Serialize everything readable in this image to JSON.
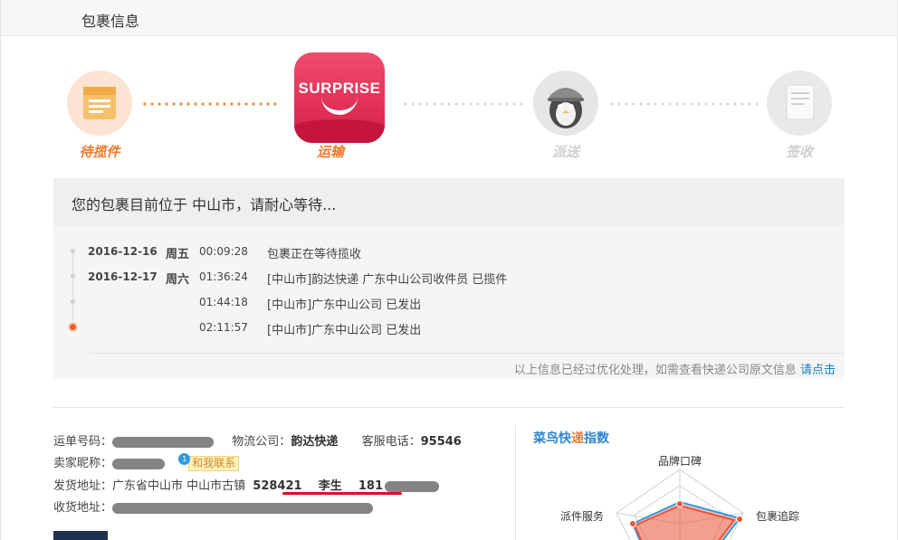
{
  "header": {
    "title": "包裹信息"
  },
  "steps": [
    {
      "label": "待揽件",
      "state": "done",
      "icon": "package-box-icon",
      "color": "#f07828"
    },
    {
      "label": "运输",
      "state": "current",
      "icon": "surprise-logo-icon",
      "logo_text": "SURPRISE",
      "color": "#f07828"
    },
    {
      "label": "派送",
      "state": "pending",
      "icon": "courier-penguin-icon",
      "color": "#cccccc"
    },
    {
      "label": "签收",
      "state": "pending",
      "icon": "signed-document-icon",
      "color": "#cccccc"
    }
  ],
  "status": {
    "message": "您的包裹目前位于 中山市，请耐心等待..."
  },
  "timeline": [
    {
      "date": "2016-12-16",
      "weekday": "周五",
      "time": "00:09:28",
      "description": "包裹正在等待揽收"
    },
    {
      "date": "2016-12-17",
      "weekday": "周六",
      "time": "01:36:24",
      "description": "[中山市]韵达快递 广东中山公司收件员 已揽件"
    },
    {
      "date": "",
      "weekday": "",
      "time": "01:44:18",
      "description": "[中山市]广东中山公司 已发出"
    },
    {
      "date": "",
      "weekday": "",
      "time": "02:11:57",
      "description": "[中山市]广东中山公司 已发出"
    }
  ],
  "footer_note": {
    "text": "以上信息已经过优化处理，如需查看快递公司原文信息",
    "link": "请点击"
  },
  "details": {
    "tracking_label": "运单号码：",
    "company_label": "物流公司：",
    "company_value": "韵达快递",
    "phone_label": "客服电话：",
    "phone_value": "95546",
    "seller_label": "卖家昵称：",
    "contact_label": "和我联系",
    "contact_bubble": "1",
    "ship_from_label": "发货地址：",
    "ship_from_value": "广东省中山市 中山市古镇",
    "postcode": "528421",
    "sender_name": "李生",
    "sender_phone_prefix": "181",
    "ship_to_label": "收货地址："
  },
  "cainiao_index": {
    "title_prefix": "菜鸟快",
    "title_highlight": "递",
    "title_suffix": "指数",
    "axes": [
      "品牌口碑",
      "包裹追踪",
      "派件服务"
    ]
  },
  "colors": {
    "accent": "#f07828",
    "brand_red": "#e4294f",
    "link": "#1a7fc3",
    "index_blue": "#2a86d1"
  }
}
